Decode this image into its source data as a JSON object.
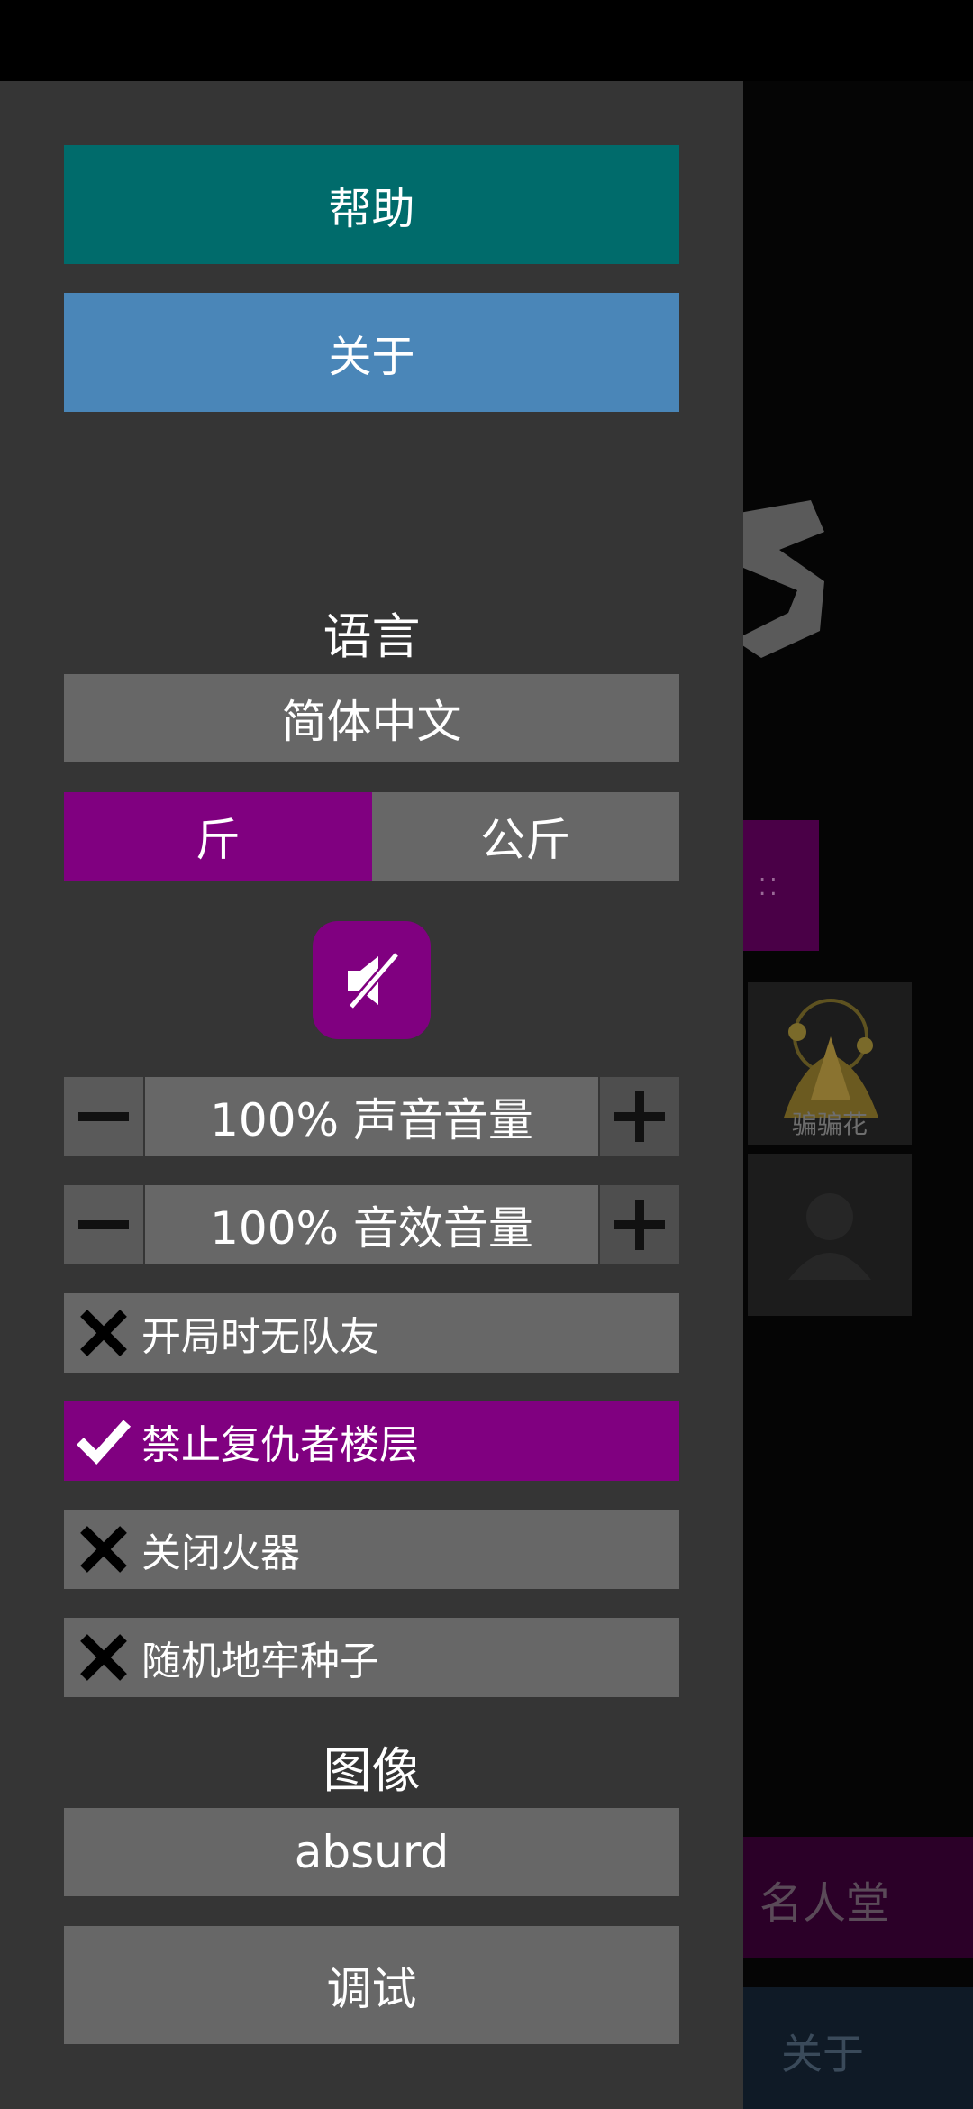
{
  "drawer": {
    "help_label": "帮助",
    "about_label": "关于",
    "language_title": "语言",
    "language_value": "简体中文",
    "units": {
      "left": "斤",
      "right": "公斤",
      "selected": "left"
    },
    "mute_icon": "speaker-muted-icon",
    "music_volume": {
      "label": "100% 声音音量",
      "minus_icon": "minus-icon",
      "plus_icon": "plus-icon"
    },
    "sfx_volume": {
      "label": "100% 音效音量",
      "minus_icon": "minus-icon",
      "plus_icon": "plus-icon"
    },
    "toggles": [
      {
        "label": "开局时无队友",
        "checked": false
      },
      {
        "label": "禁止复仇者楼层",
        "checked": true
      },
      {
        "label": "关闭火器",
        "checked": false
      },
      {
        "label": "随机地牢种子",
        "checked": false
      }
    ],
    "graphics_title": "图像",
    "graphics_value": "absurd",
    "debug_label": "调试"
  },
  "background": {
    "card_label": "骗骗花",
    "hall_label": "名人堂",
    "about_label": "关于"
  },
  "colors": {
    "teal": "#006b6b",
    "blue": "#4a86b8",
    "purple": "#800080",
    "grey": "#676767",
    "drawer_bg": "#353535"
  }
}
